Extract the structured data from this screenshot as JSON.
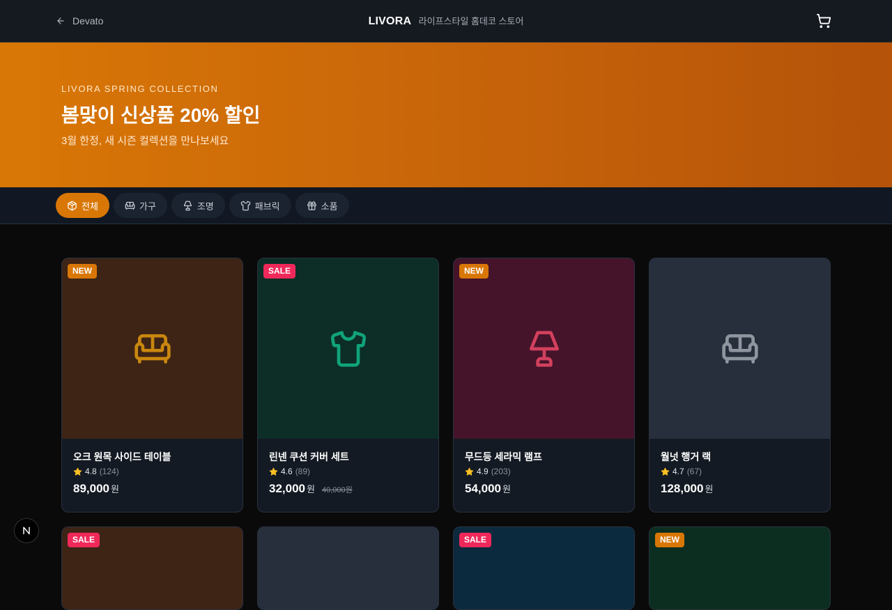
{
  "nav": {
    "back_label": "Devato"
  },
  "brand": {
    "name": "LIVORA",
    "tagline": "라이프스타일 홈데코 스토어"
  },
  "hero": {
    "eyebrow": "LIVORA SPRING COLLECTION",
    "title": "봄맞이 신상품 20% 할인",
    "subtitle": "3월 한정, 새 시즌 컬렉션을 만나보세요"
  },
  "categories": [
    {
      "label": "전체",
      "icon": "box-icon",
      "active": true
    },
    {
      "label": "가구",
      "icon": "sofa-icon",
      "active": false
    },
    {
      "label": "조명",
      "icon": "lamp-icon",
      "active": false
    },
    {
      "label": "패브릭",
      "icon": "shirt-icon",
      "active": false
    },
    {
      "label": "소품",
      "icon": "gift-icon",
      "active": false
    }
  ],
  "products": [
    {
      "badge": "NEW",
      "icon": "sofa-icon",
      "name": "오크 원목 사이드 테이블",
      "rating": "4.8",
      "reviews": "(124)",
      "price": "89,000",
      "currency": "원",
      "original_price": "",
      "bg": "#3d2415",
      "icon_color": "#c9870f"
    },
    {
      "badge": "SALE",
      "icon": "shirt-icon",
      "name": "린넨 쿠션 커버 세트",
      "rating": "4.6",
      "reviews": "(89)",
      "price": "32,000",
      "currency": "원",
      "original_price": "40,000원",
      "bg": "#0c2e27",
      "icon_color": "#10a37a"
    },
    {
      "badge": "NEW",
      "icon": "lamp-icon",
      "name": "무드등 세라믹 램프",
      "rating": "4.9",
      "reviews": "(203)",
      "price": "54,000",
      "currency": "원",
      "original_price": "",
      "bg": "#46142a",
      "icon_color": "#d2405e"
    },
    {
      "badge": "",
      "icon": "sofa-icon",
      "name": "월넛 행거 랙",
      "rating": "4.7",
      "reviews": "(67)",
      "price": "128,000",
      "currency": "원",
      "original_price": "",
      "bg": "#272f3d",
      "icon_color": "#8e959f"
    },
    {
      "badge": "SALE",
      "bg": "#3d2415"
    },
    {
      "badge": "",
      "bg": "#272f3d"
    },
    {
      "badge": "SALE",
      "bg": "#0c2a3d"
    },
    {
      "badge": "NEW",
      "bg": "#0c2e20"
    }
  ],
  "colors": {
    "accent": "#d97706",
    "sale": "#f0285a",
    "star": "#fbbf24"
  }
}
